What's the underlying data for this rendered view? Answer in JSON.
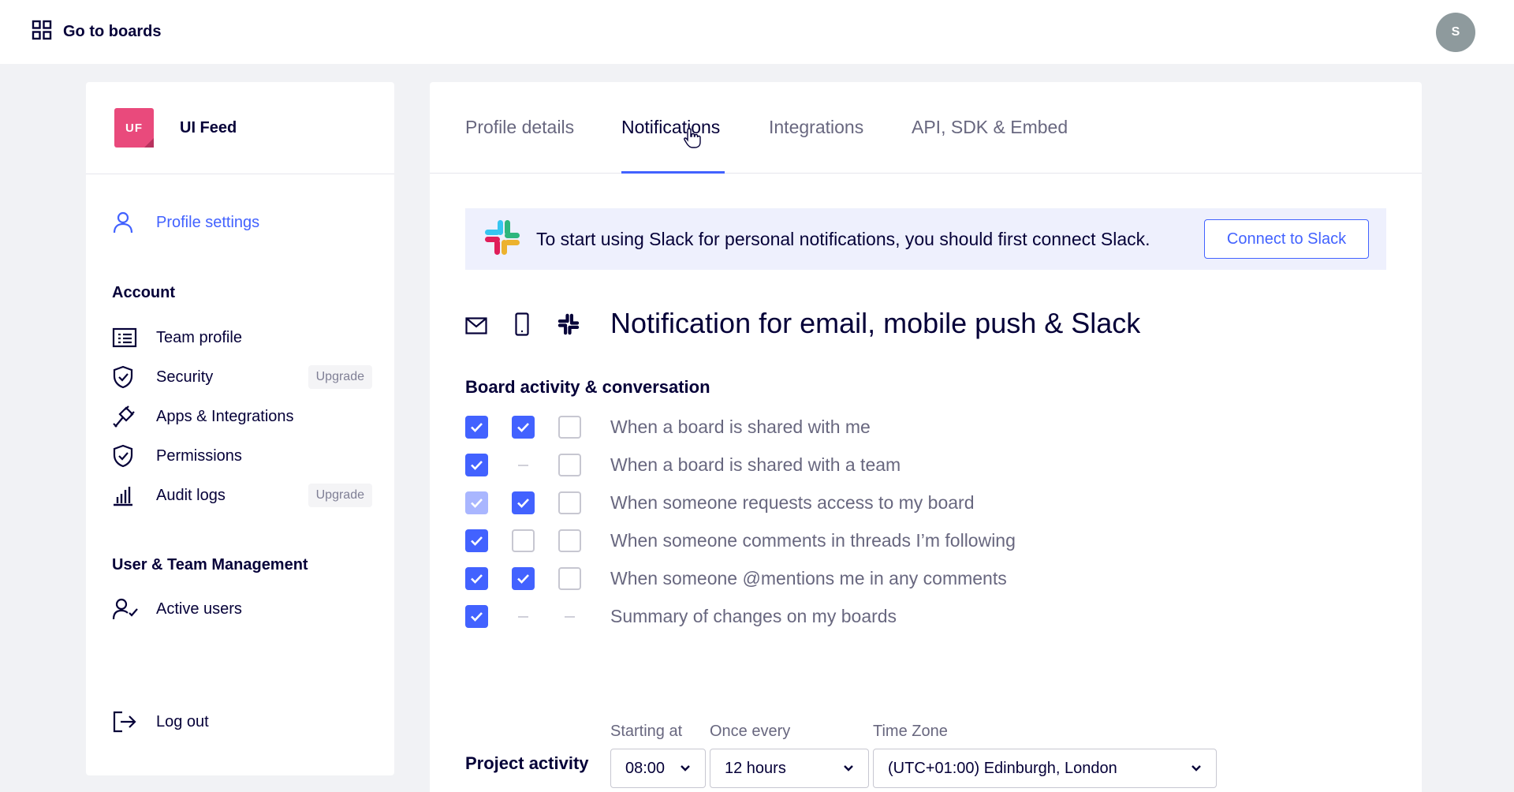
{
  "topbar": {
    "goto_label": "Go to boards",
    "avatar_initial": "S"
  },
  "sidebar": {
    "team_initials": "UF",
    "team_name": "UI Feed",
    "profile_settings": "Profile settings",
    "account_heading": "Account",
    "items": [
      {
        "label": "Team profile",
        "icon": "team-profile-icon"
      },
      {
        "label": "Security",
        "icon": "shield-icon",
        "badge": "Upgrade"
      },
      {
        "label": "Apps & Integrations",
        "icon": "plug-icon"
      },
      {
        "label": "Permissions",
        "icon": "shield-icon"
      },
      {
        "label": "Audit logs",
        "icon": "bar-chart-icon",
        "badge": "Upgrade"
      }
    ],
    "management_heading": "User & Team Management",
    "active_users": "Active users",
    "logout": "Log out"
  },
  "tabs": [
    "Profile details",
    "Notifications",
    "Integrations",
    "API, SDK & Embed"
  ],
  "active_tab": "Notifications",
  "banner": {
    "text": "To start using Slack for personal notifications, you should first connect Slack.",
    "button": "Connect to Slack"
  },
  "section_title": "Notification for email, mobile push & Slack",
  "board_section": {
    "title": "Board activity & conversation",
    "rows": [
      {
        "label": "When a board is shared with me",
        "email": "on",
        "mobile": "on",
        "slack": "off"
      },
      {
        "label": "When a board is shared with a team",
        "email": "on",
        "mobile": "na",
        "slack": "off"
      },
      {
        "label": "When someone requests access to my board",
        "email": "on-light",
        "mobile": "on",
        "slack": "off"
      },
      {
        "label": "When someone comments in threads I’m following",
        "email": "on",
        "mobile": "off",
        "slack": "off"
      },
      {
        "label": "When someone @mentions me in any comments",
        "email": "on",
        "mobile": "on",
        "slack": "off"
      },
      {
        "label": "Summary of changes on my boards",
        "email": "on",
        "mobile": "na",
        "slack": "na"
      }
    ]
  },
  "summary_settings": {
    "starting_at_label": "Starting at",
    "starting_at_value": "08:00",
    "once_every_label": "Once every",
    "once_every_value": "12 hours",
    "timezone_label": "Time Zone",
    "timezone_value": "(UTC+01:00) Edinburgh, London"
  },
  "project_section_title": "Project activity",
  "colors": {
    "accent": "#4262ff",
    "text": "#050038",
    "muted": "#68677f",
    "team_logo": "#e94a7c"
  }
}
